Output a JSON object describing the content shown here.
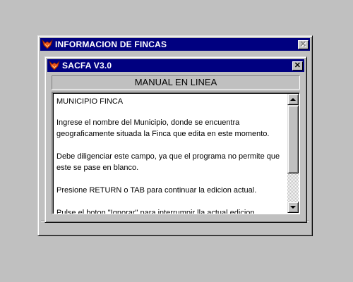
{
  "outer_window": {
    "title": "INFORMACION DE FINCAS",
    "icon": "fox-logo-icon",
    "close_label": "✕"
  },
  "inner_window": {
    "title": "SACFA V3.0",
    "icon": "fox-logo-icon",
    "close_label": "✕"
  },
  "help_panel": {
    "header": "MANUAL EN LINEA",
    "paragraphs": [
      "MUNICIPIO FINCA",
      "Ingrese el nombre del Municipio, donde se encuentra geograficamente situada la Finca que edita en este momento.",
      "Debe diligenciar este campo, ya que el programa no permite que este se pase en blanco.",
      "Presione RETURN o TAB  para continuar la edicion actual.",
      "Pulse el boton \"Ignorar\" para interrumpir lla actual edicion, desechando sus cambios."
    ]
  },
  "colors": {
    "titlebar": "#000080",
    "face": "#c0c0c0",
    "text_bg": "#ffffff",
    "icon_orange": "#e8501a"
  }
}
